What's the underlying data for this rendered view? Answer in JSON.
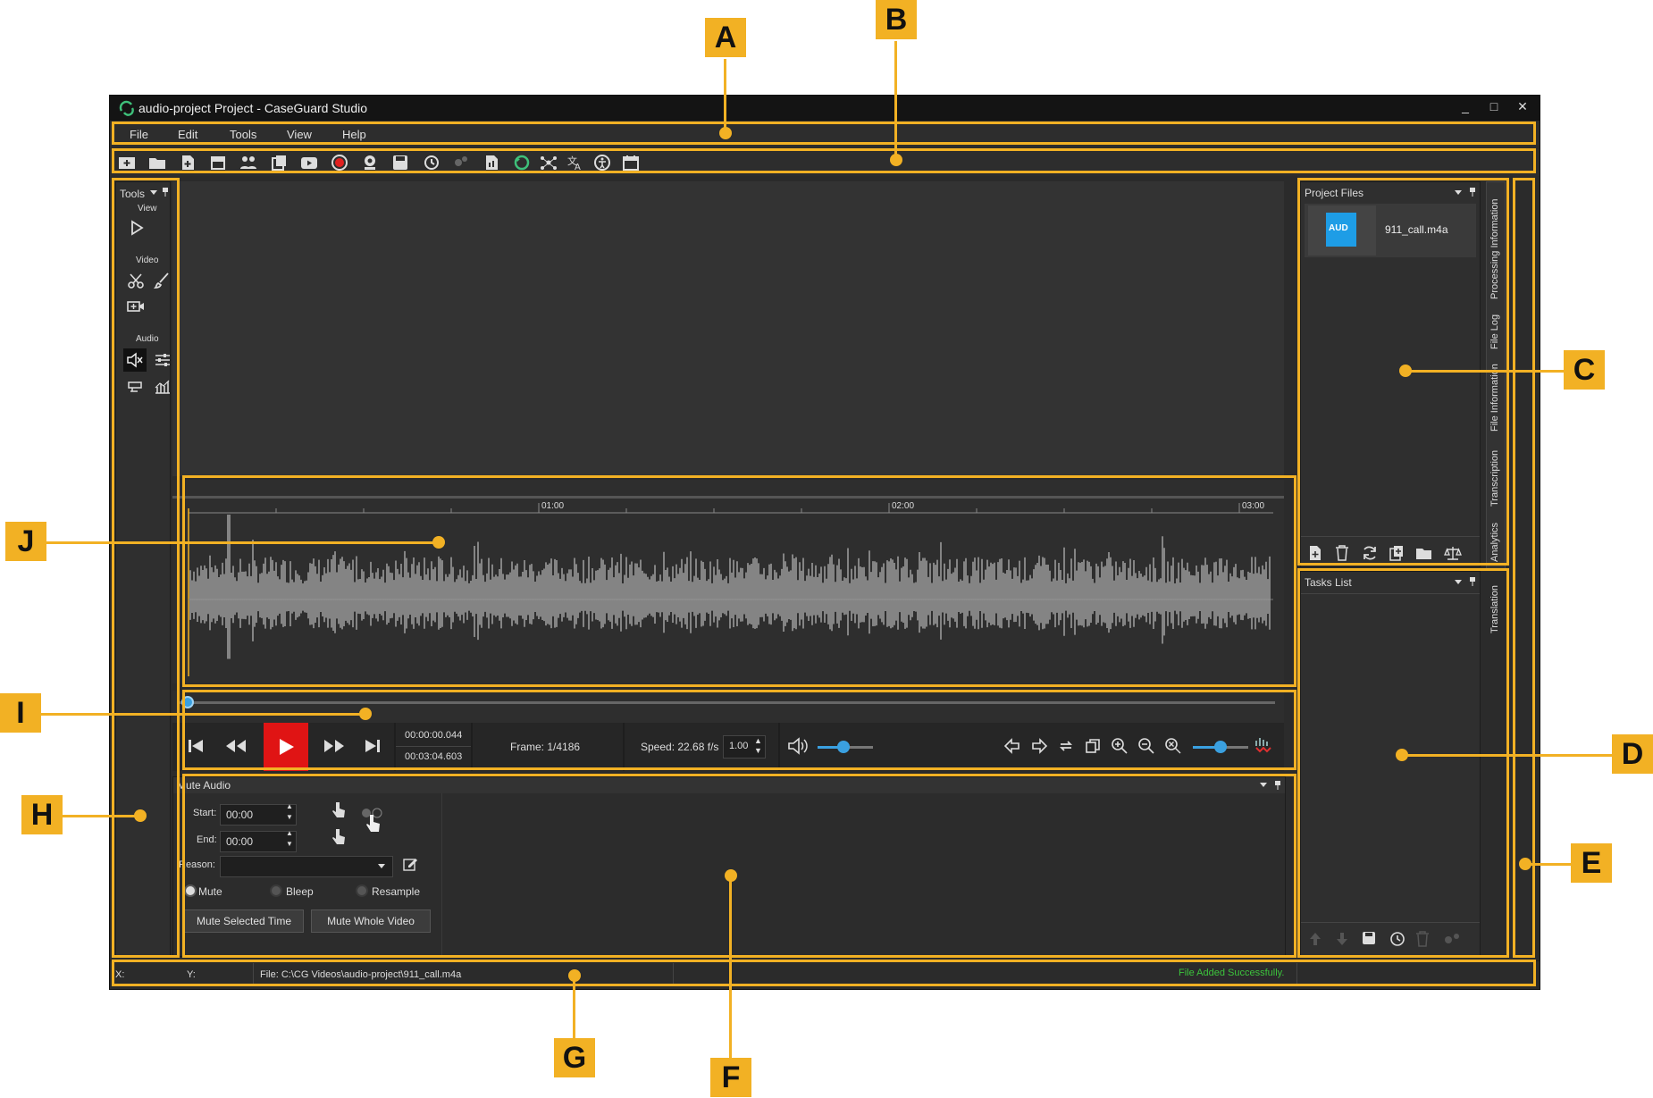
{
  "window": {
    "title": "audio-project Project - CaseGuard Studio",
    "minimize": "_",
    "maximize": "□",
    "close": "✕"
  },
  "menu": [
    "File",
    "Edit",
    "Tools",
    "View",
    "Help"
  ],
  "tools_panel": {
    "title": "Tools",
    "section_view": "View",
    "section_video": "Video",
    "section_audio": "Audio"
  },
  "project_files": {
    "title": "Project Files",
    "file_badge": "AUD",
    "file_name": "911_call.m4a"
  },
  "tasks_list": {
    "title": "Tasks List"
  },
  "side_tabs": [
    "Processing Information",
    "File Log",
    "File Information",
    "Transcription",
    "Analytics",
    "Translation"
  ],
  "timeline": {
    "ticks": [
      "01:00",
      "02:00",
      "03:00"
    ]
  },
  "transport": {
    "current_time": "00:00:00.044",
    "total_time": "00:03:04.603",
    "frame": "Frame: 1/4186",
    "speed_label": "Speed: 22.68 f/s",
    "speed_value": "1.00"
  },
  "mute_audio": {
    "title": "Mute Audio",
    "start_label": "Start:",
    "start_value": "00:00",
    "end_label": "End:",
    "end_value": "00:00",
    "reason_label": "Reason:",
    "options": [
      "Mute",
      "Bleep",
      "Resample"
    ],
    "btn_selected": "Mute Selected Time",
    "btn_whole": "Mute Whole Video"
  },
  "status": {
    "x": "X:",
    "y": "Y:",
    "file": "File: C:\\CG Videos\\audio-project\\911_call.m4a",
    "message": "File Added Successfully.",
    "message_color": "#3cc43c"
  },
  "callouts": [
    "A",
    "B",
    "C",
    "D",
    "E",
    "F",
    "G",
    "H",
    "I",
    "J"
  ],
  "accent": "#f2b124"
}
